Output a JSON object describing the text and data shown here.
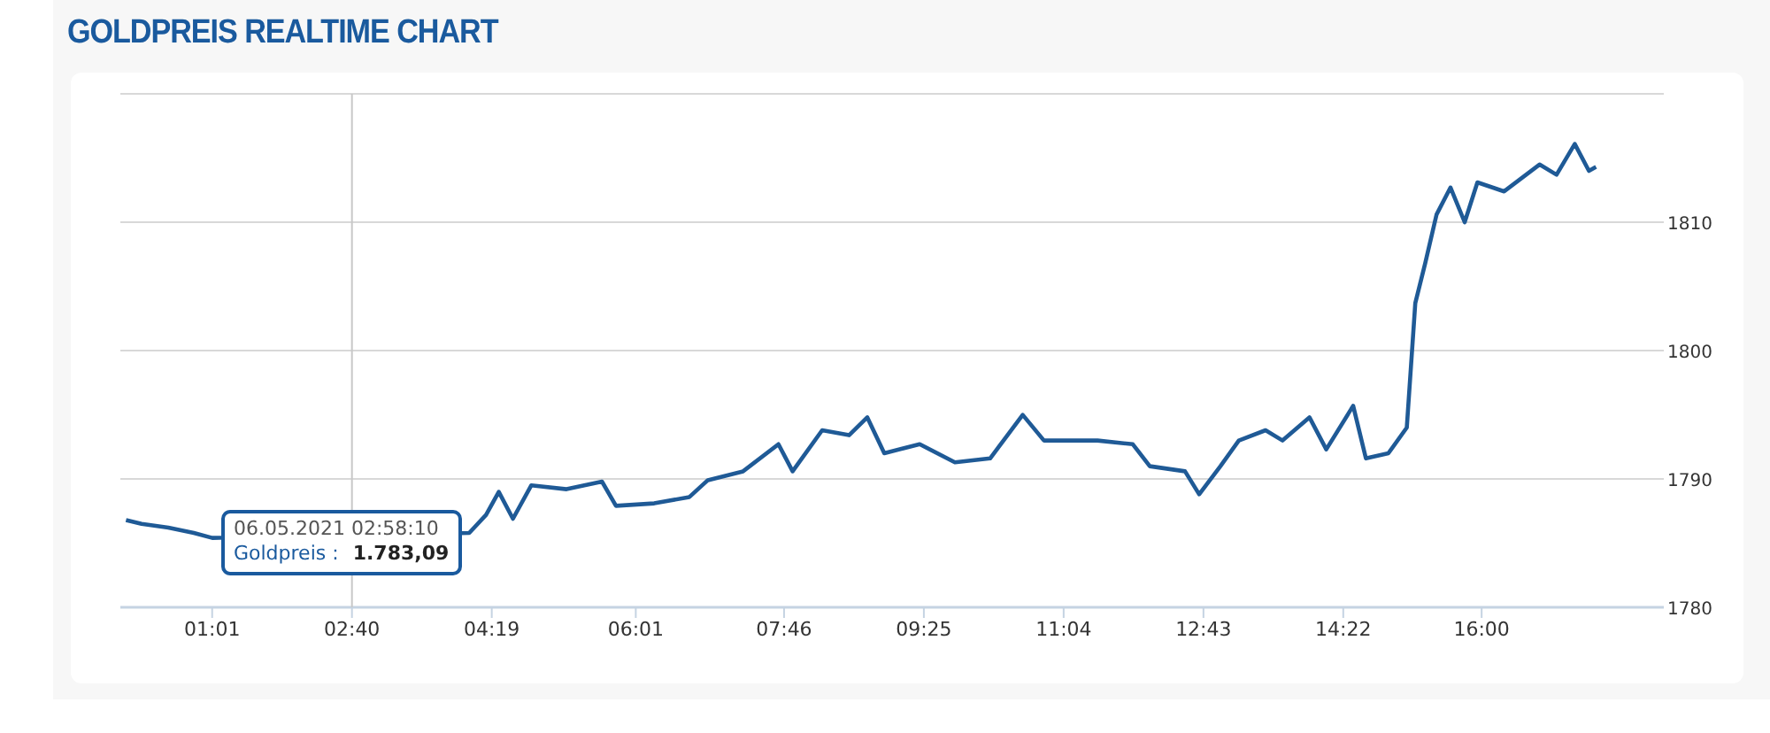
{
  "title": "GOLDPREIS REALTIME CHART",
  "chart": {
    "chart_data": {
      "type": "line",
      "grid": true,
      "ref_lines": [
        {
          "axis": "x",
          "value": 160
        }
      ],
      "xlim": [
        -4,
        1089
      ],
      "ylim": [
        1780,
        1820
      ],
      "yticks": [
        1780,
        1790,
        1800,
        1810
      ],
      "xticks": [
        {
          "value": 61,
          "label": "01:01"
        },
        {
          "value": 160,
          "label": "02:40"
        },
        {
          "value": 259,
          "label": "04:19"
        },
        {
          "value": 361,
          "label": "06:01"
        },
        {
          "value": 466,
          "label": "07:46"
        },
        {
          "value": 565,
          "label": "09:25"
        },
        {
          "value": 664,
          "label": "11:04"
        },
        {
          "value": 763,
          "label": "12:43"
        },
        {
          "value": 862,
          "label": "14:22"
        },
        {
          "value": 960,
          "label": "16:00"
        }
      ],
      "x": [
        0,
        11,
        30,
        48,
        61,
        243,
        255,
        264,
        274,
        287,
        312,
        337,
        347,
        374,
        399,
        412,
        437,
        462,
        472,
        493,
        512,
        525,
        537,
        562,
        587,
        612,
        635,
        650,
        688,
        713,
        725,
        750,
        760,
        775,
        788,
        807,
        819,
        838,
        850,
        869,
        878,
        894,
        907,
        913,
        920,
        928,
        938,
        948,
        957,
        976,
        1001,
        1013,
        1026,
        1036,
        1041
      ],
      "series": [
        {
          "name": "Goldpreis",
          "color": "#1f5a96",
          "values": [
            1786.8,
            1786.5,
            1786.2,
            1785.8,
            1785.4,
            1785.8,
            1787.2,
            1789.0,
            1786.9,
            1789.5,
            1789.2,
            1789.8,
            1787.9,
            1788.1,
            1788.6,
            1789.9,
            1790.6,
            1792.7,
            1790.6,
            1793.8,
            1793.4,
            1794.8,
            1792.0,
            1792.7,
            1791.3,
            1791.6,
            1795.0,
            1793.0,
            1793.0,
            1792.7,
            1791.0,
            1790.6,
            1788.8,
            1791.0,
            1793.0,
            1793.8,
            1793.0,
            1794.8,
            1792.3,
            1795.7,
            1791.6,
            1792.0,
            1794.0,
            1803.7,
            1806.8,
            1810.6,
            1812.7,
            1810.0,
            1813.1,
            1812.4,
            1814.5,
            1813.7,
            1816.1,
            1814.0,
            1814.3
          ]
        }
      ]
    },
    "tooltip": {
      "date": "06.05.2021 02:58:10",
      "separator": ":",
      "value": "1.783,09"
    }
  }
}
